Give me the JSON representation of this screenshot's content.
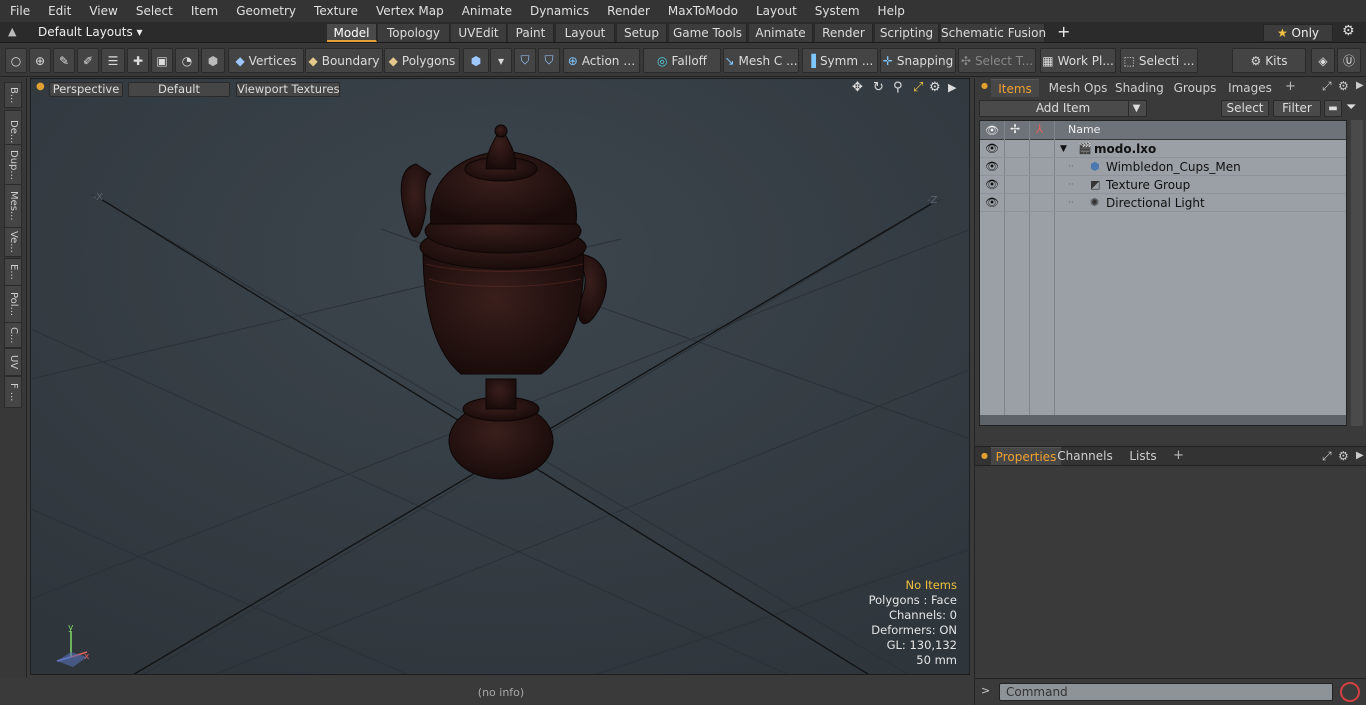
{
  "menu": [
    "File",
    "Edit",
    "View",
    "Select",
    "Item",
    "Geometry",
    "Texture",
    "Vertex Map",
    "Animate",
    "Dynamics",
    "Render",
    "MaxToModo",
    "Layout",
    "System",
    "Help"
  ],
  "layouts_label": "Default Layouts",
  "tabs": [
    "Model",
    "Topology",
    "UVEdit",
    "Paint",
    "Layout",
    "Setup",
    "Game Tools",
    "Animate",
    "Render",
    "Scripting",
    "Schematic Fusion"
  ],
  "only_label": "Only",
  "toolbar": {
    "vertices": "Vertices",
    "boundary": "Boundary",
    "polygons": "Polygons",
    "action": "Action",
    "falloff": "Falloff",
    "mesh": "Mesh C ...",
    "symm": "Symm ...",
    "snapping": "Snapping",
    "select_t": "Select T...",
    "work_pl": "Work Pl...",
    "selecti": "Selecti ...",
    "kits": "Kits"
  },
  "left_tabs": [
    "B...",
    "De...",
    "Dup...",
    "Mes...",
    "Ve...",
    "E...",
    "Pol...",
    "C...",
    "UV",
    "F ..."
  ],
  "viewport": {
    "perspective": "Perspective",
    "default": "Default",
    "textures": "Viewport Textures",
    "axis_x": "-X",
    "axis_z": "-Z",
    "stats": {
      "no_items": "No Items",
      "polygons": "Polygons : Face",
      "channels": "Channels: 0",
      "deformers": "Deformers: ON",
      "gl": "GL: 130,132",
      "size": "50 mm"
    }
  },
  "status_info": "(no info)",
  "panel": {
    "tabs": [
      "Items",
      "Mesh Ops",
      "Shading",
      "Groups",
      "Images"
    ],
    "add_item": "Add Item",
    "select": "Select",
    "filter": "Filter",
    "name_header": "Name",
    "items": [
      {
        "name": "modo.lxo",
        "icon": "scene-icon",
        "indent": 0,
        "bold": true
      },
      {
        "name": "Wimbledon_Cups_Men",
        "icon": "mesh-icon",
        "indent": 1,
        "bold": false
      },
      {
        "name": "Texture Group",
        "icon": "texture-group-icon",
        "indent": 1,
        "bold": false
      },
      {
        "name": "Directional Light",
        "icon": "light-icon",
        "indent": 1,
        "bold": false
      }
    ],
    "bottom_tabs": [
      "Properties",
      "Channels",
      "Lists"
    ],
    "command_placeholder": "Command"
  },
  "colors": {
    "accent": "#e3a03a",
    "highlight": "#f0c040"
  }
}
